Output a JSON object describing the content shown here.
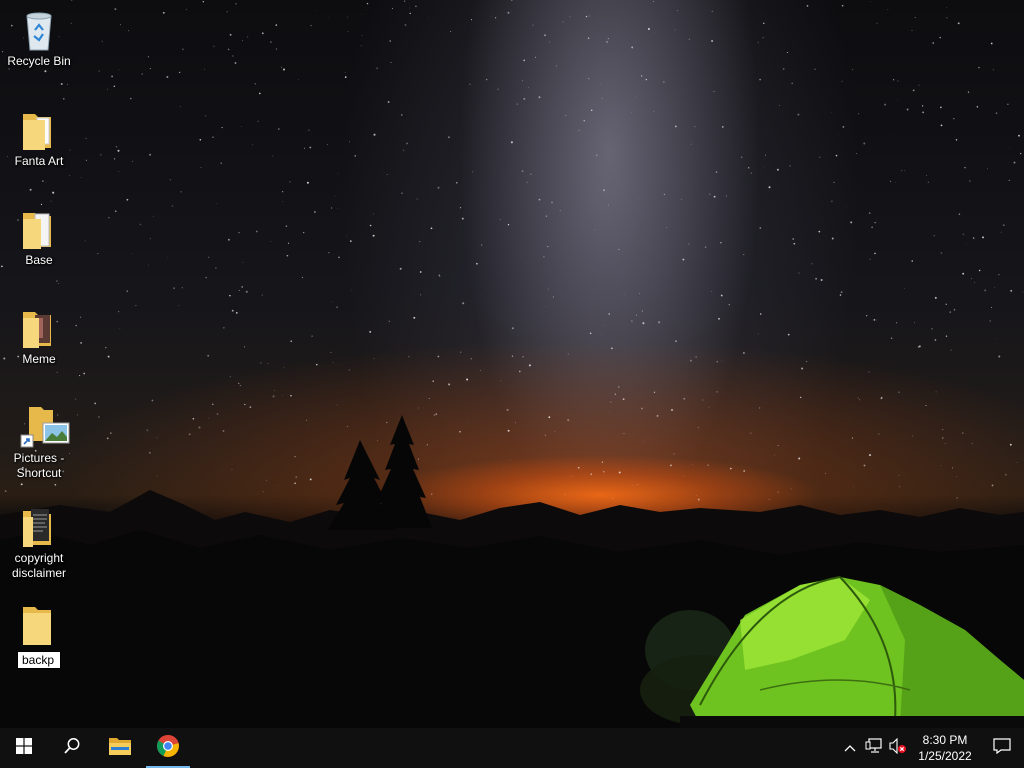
{
  "desktop": {
    "icons": [
      {
        "label": "Recycle Bin",
        "type": "recycle-bin"
      },
      {
        "label": "Fanta Art",
        "type": "folder"
      },
      {
        "label": "Base",
        "type": "folder"
      },
      {
        "label": "Meme",
        "type": "folder"
      },
      {
        "label": "Pictures -\nShortcut",
        "type": "shortcut"
      },
      {
        "label": "copyright\ndisclaimer",
        "type": "folder"
      }
    ],
    "rename": {
      "value": "backp"
    }
  },
  "taskbar": {
    "start": "windows-logo-icon",
    "search": "search-icon",
    "pinned": [
      "file-explorer-icon",
      "chrome-icon"
    ],
    "active_app": "chrome-icon",
    "tray": {
      "icons": [
        "chevron-up-icon",
        "network-icon",
        "volume-muted-icon"
      ],
      "time": "8:30 PM",
      "date": "1/25/2022",
      "notifications": "action-center-icon"
    },
    "accent": "#76b9ed"
  }
}
